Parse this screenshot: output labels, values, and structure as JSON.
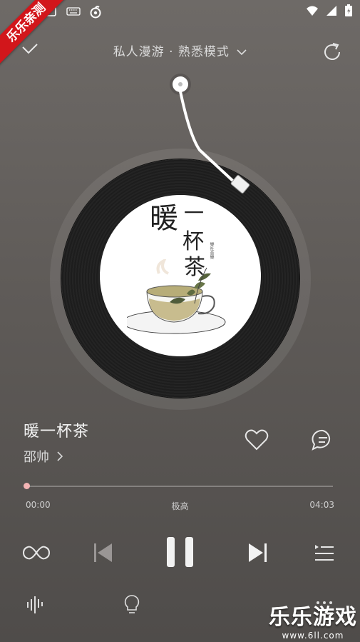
{
  "ribbon": {
    "text": "乐乐亲测"
  },
  "header": {
    "title": "私人漫游 · 熟悉模式"
  },
  "album_art": {
    "text_1": "暖",
    "text_2": "一",
    "text_3": "杯",
    "text_4": "茶",
    "small_text": "樂社音樂"
  },
  "song": {
    "title": "暖一杯茶",
    "artist": "邵帅"
  },
  "progress": {
    "current": "00:00",
    "total": "04:03",
    "quality": "极高",
    "fraction": 0
  },
  "watermark": {
    "title": "乐乐游戏",
    "url": "www.6ll.com"
  },
  "colors": {
    "ribbon": "#d2161b",
    "progress_dot": "#f3b4b4"
  }
}
